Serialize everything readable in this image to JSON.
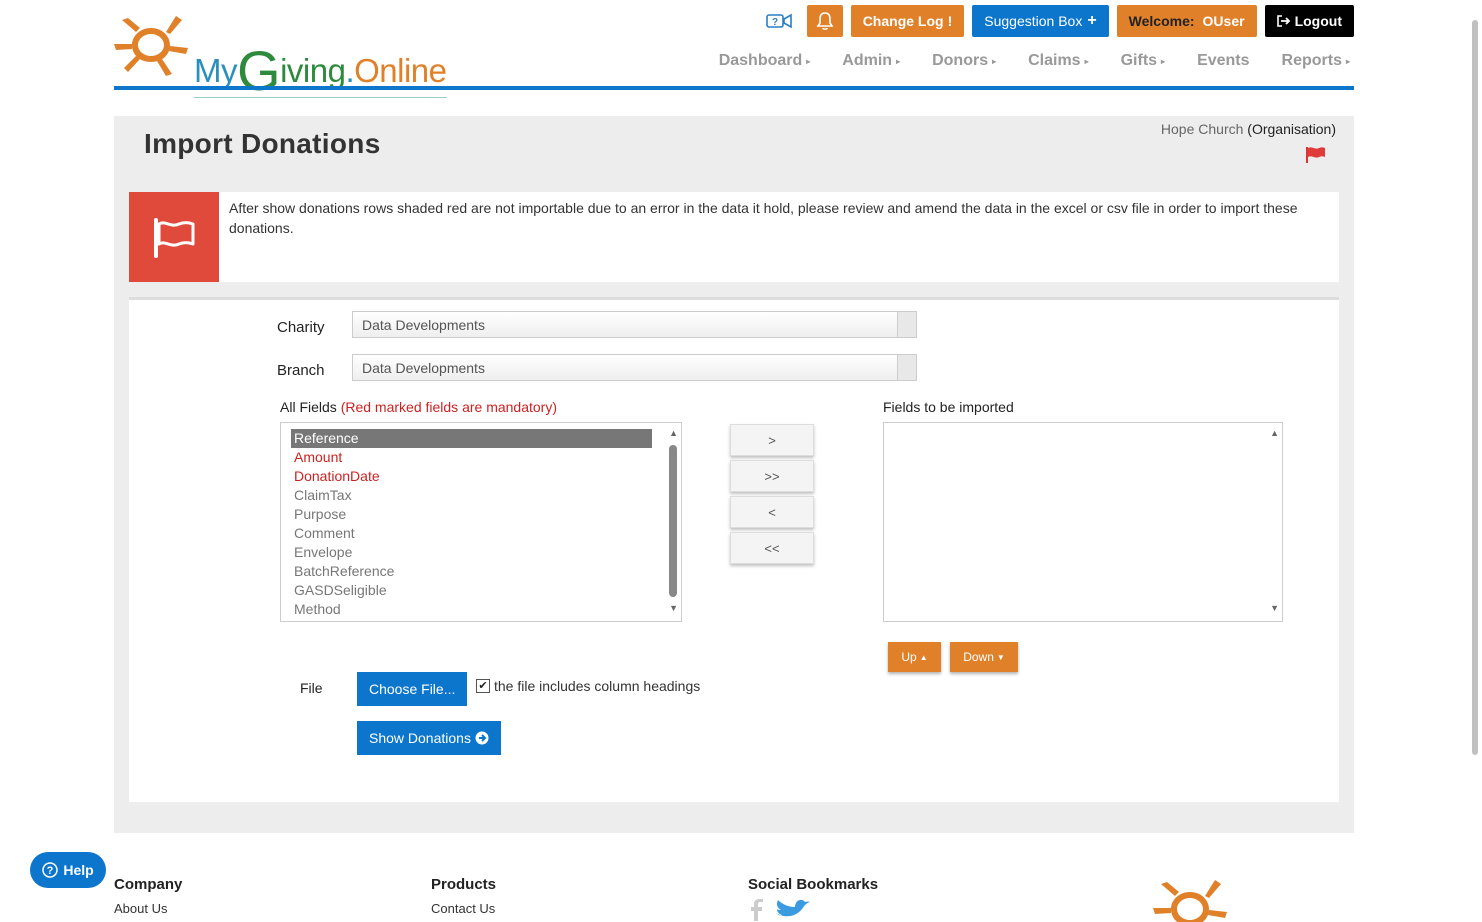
{
  "brand": {
    "my": "My",
    "g": "G",
    "iving": "iving",
    "dot": ".",
    "online": "Online"
  },
  "topbar": {
    "change_log": "Change Log",
    "change_log_mark": "!",
    "suggestion_box": "Suggestion Box",
    "welcome_label": "Welcome:",
    "username": "OUser",
    "logout": "Logout"
  },
  "nav": {
    "items": [
      {
        "label": "Dashboard",
        "has_menu": true
      },
      {
        "label": "Admin",
        "has_menu": true
      },
      {
        "label": "Donors",
        "has_menu": true
      },
      {
        "label": "Claims",
        "has_menu": true
      },
      {
        "label": "Gifts",
        "has_menu": true
      },
      {
        "label": "Events",
        "has_menu": false
      },
      {
        "label": "Reports",
        "has_menu": true
      }
    ]
  },
  "page": {
    "title": "Import Donations",
    "org_name": "Hope Church",
    "org_type": "(Organisation)"
  },
  "alert": {
    "text": "After show donations rows shaded red are not importable due to an error in the data it hold, please review and amend the data in the excel or csv file in order to import these donations."
  },
  "form": {
    "charity_label": "Charity",
    "charity_value": "Data Developments",
    "branch_label": "Branch",
    "branch_value": "Data Developments",
    "all_fields_label": "All Fields",
    "mandatory_note": "(Red marked fields are mandatory)",
    "fields_to_import_label": "Fields to be imported",
    "all_fields": [
      {
        "label": "Reference",
        "selected": true,
        "mandatory": false
      },
      {
        "label": "Amount",
        "selected": false,
        "mandatory": true
      },
      {
        "label": "DonationDate",
        "selected": false,
        "mandatory": true
      },
      {
        "label": "ClaimTax",
        "selected": false,
        "mandatory": false
      },
      {
        "label": "Purpose",
        "selected": false,
        "mandatory": false
      },
      {
        "label": "Comment",
        "selected": false,
        "mandatory": false
      },
      {
        "label": "Envelope",
        "selected": false,
        "mandatory": false
      },
      {
        "label": "BatchReference",
        "selected": false,
        "mandatory": false
      },
      {
        "label": "GASDSeligible",
        "selected": false,
        "mandatory": false
      },
      {
        "label": "Method",
        "selected": false,
        "mandatory": false
      }
    ],
    "move_buttons": {
      "add": ">",
      "add_all": ">>",
      "remove": "<",
      "remove_all": "<<"
    },
    "up_label": "Up",
    "down_label": "Down",
    "file_label": "File",
    "choose_file": "Choose File...",
    "headings_checkbox_label": "the file includes column headings",
    "headings_checked": true,
    "show_donations": "Show Donations"
  },
  "footer": {
    "company_heading": "Company",
    "company_link": "About Us",
    "products_heading": "Products",
    "products_link": "Contact Us",
    "social_heading": "Social Bookmarks"
  },
  "help_label": "Help",
  "colors": {
    "brand_blue": "#0b76cc",
    "brand_orange": "#e0812a",
    "alert_red": "#e04a3a",
    "mandatory_red": "#cc2222"
  }
}
